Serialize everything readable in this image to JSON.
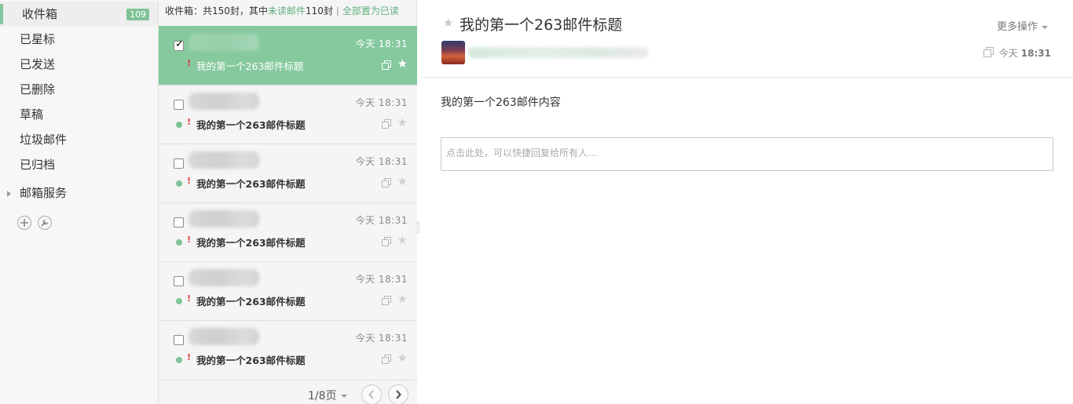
{
  "sidebar": {
    "folders": [
      {
        "label": "收件箱",
        "badge": "109"
      },
      {
        "label": "已星标"
      },
      {
        "label": "已发送"
      },
      {
        "label": "已删除"
      },
      {
        "label": "草稿"
      },
      {
        "label": "垃圾邮件"
      },
      {
        "label": "已归档"
      }
    ],
    "service_label": "邮箱服务",
    "add_icon": "plus-circle-icon",
    "tool_icon": "wrench-icon"
  },
  "list": {
    "summary_prefix": "收件箱：共150封，其中",
    "summary_unread": "未读邮件",
    "summary_count": "110封",
    "summary_separator": "|",
    "mark_all_read": "全部置为已读",
    "items": [
      {
        "subject": "我的第一个263邮件标题",
        "time": "今天  18:31",
        "selected": true,
        "unread": false
      },
      {
        "subject": "我的第一个263邮件标题",
        "time": "今天  18:31",
        "selected": false,
        "unread": true
      },
      {
        "subject": "我的第一个263邮件标题",
        "time": "今天  18:31",
        "selected": false,
        "unread": true
      },
      {
        "subject": "我的第一个263邮件标题",
        "time": "今天  18:31",
        "selected": false,
        "unread": true
      },
      {
        "subject": "我的第一个263邮件标题",
        "time": "今天  18:31",
        "selected": false,
        "unread": true
      },
      {
        "subject": "我的第一个263邮件标题",
        "time": "今天  18:31",
        "selected": false,
        "unread": true
      }
    ],
    "priority_mark": "!",
    "star_glyph": "★",
    "page_info": "1/8页"
  },
  "reader": {
    "title": "我的第一个263邮件标题",
    "more_actions": "更多操作",
    "time_day": "今天",
    "time_clock": "18:31",
    "body": "我的第一个263邮件内容",
    "reply_placeholder": "点击此处，可以快捷回复给所有人...",
    "star_glyph": "★"
  },
  "colors": {
    "accent": "#86c99e",
    "badge": "#7fc397",
    "link": "#5fae7c",
    "priority": "#e23a3a"
  }
}
